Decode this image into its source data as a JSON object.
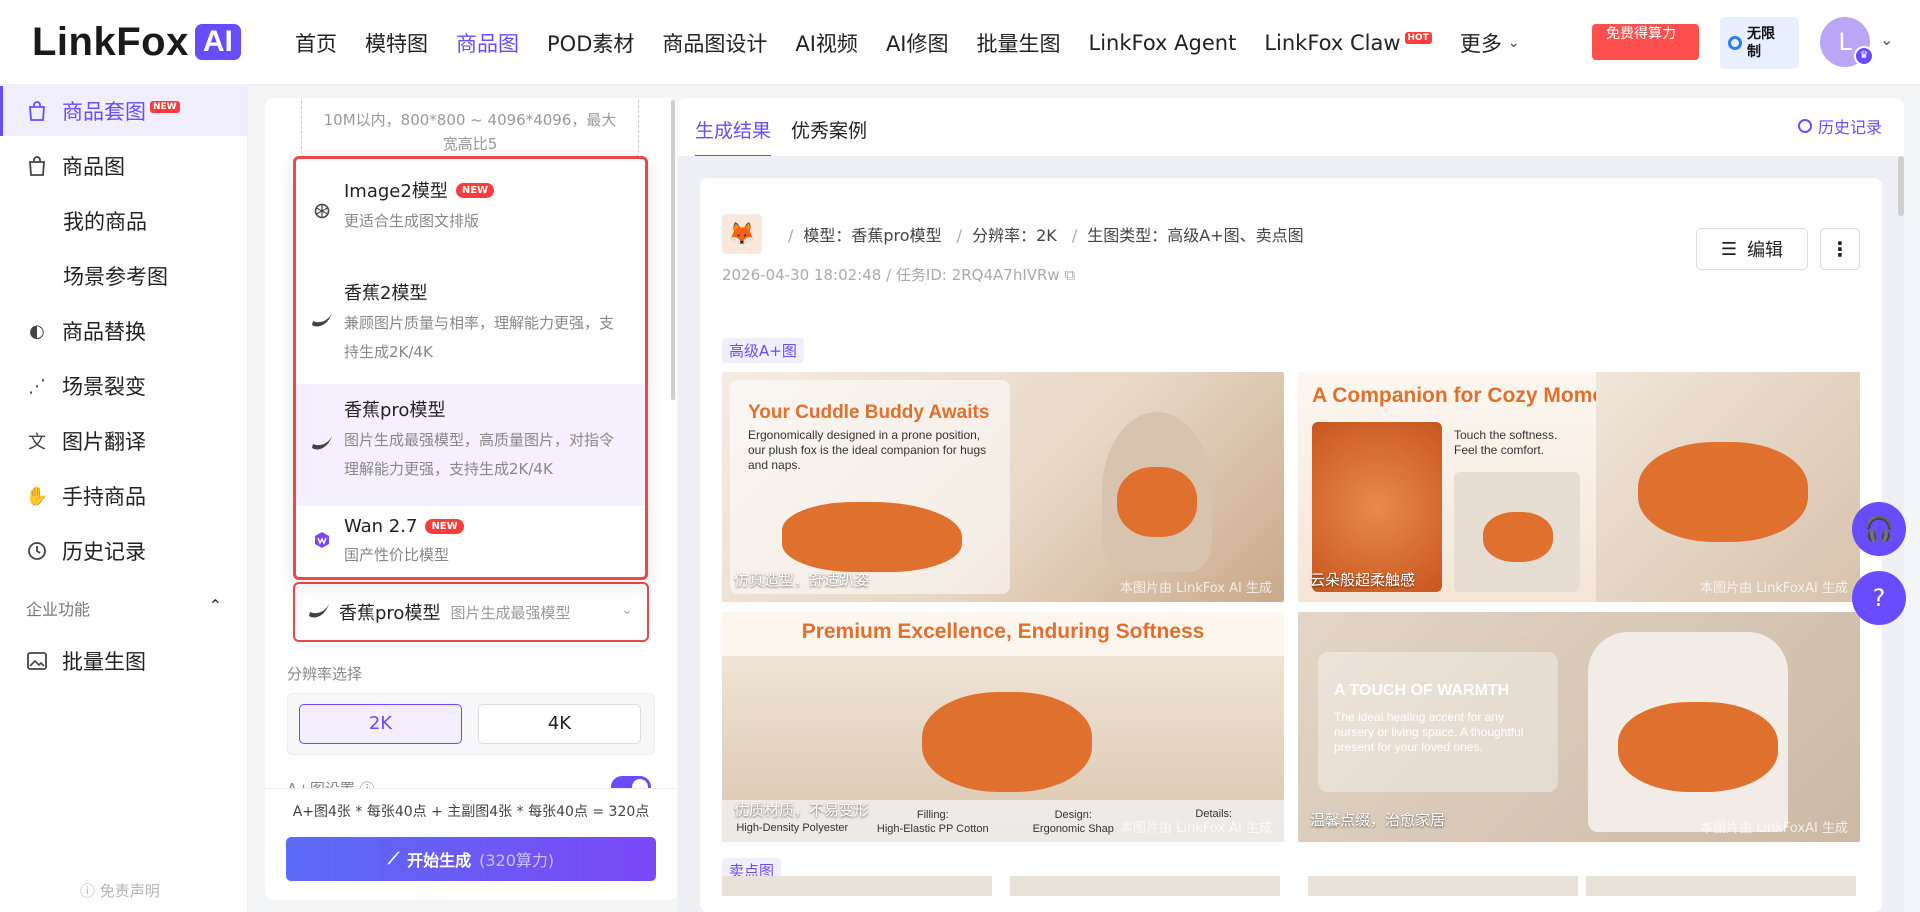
{
  "brand": {
    "name": "LinkFox",
    "ai": "AI"
  },
  "nav": {
    "items": [
      "首页",
      "模特图",
      "商品图",
      "POD素材",
      "商品图设计",
      "AI视频",
      "AI修图",
      "批量生图",
      "LinkFox Agent",
      "LinkFox Claw"
    ],
    "hot_badge": "HOT",
    "more": "更多",
    "promo": "免费得算力",
    "unlimited": "无限制",
    "avatar_initial": "L"
  },
  "sidebar": {
    "items": [
      "商品套图",
      "商品图",
      "我的商品",
      "场景参考图",
      "商品替换",
      "场景裂变",
      "图片翻译",
      "手持商品",
      "历史记录"
    ],
    "new_badge": "NEW",
    "group_title": "企业功能",
    "batch": "批量生图",
    "disclaimer": "免责声明"
  },
  "panel": {
    "upload_hint": "10M以内，800*800 ~ 4096*4096，最大宽高比5",
    "selected_model": "香蕉pro模型",
    "selected_model_desc": "图片生成最强模型",
    "resolution_label": "分辨率选择",
    "res_2k": "2K",
    "res_4k": "4K",
    "aplus_label": "A+图设置",
    "formula": "A+图4张 * 每张40点 + 主副图4张 * 每张40点 = 320点",
    "generate": "开始生成",
    "generate_cost": "(320算力)"
  },
  "dropdown": {
    "options": [
      {
        "title": "Image2模型",
        "badge": "NEW",
        "desc": "更适合生成图文排版"
      },
      {
        "title": "香蕉2模型",
        "badge": "",
        "desc": "兼顾图片质量与相率，理解能力更强，支持生成2K/4K"
      },
      {
        "title": "香蕉pro模型",
        "badge": "",
        "desc": "图片生成最强模型，高质量图片，对指令理解能力更强，支持生成2K/4K"
      },
      {
        "title": "Wan 2.7",
        "badge": "NEW",
        "desc": "国产性价比模型"
      }
    ]
  },
  "results": {
    "tab_results": "生成结果",
    "tab_cases": "优秀案例",
    "history": "历史记录",
    "meta_model": "模型：香蕉pro模型",
    "meta_res": "分辨率：2K",
    "meta_type": "生图类型：高级A+图、卖点图",
    "meta_sub": "2026-04-30 18:02:48 / 任务ID: 2RQ4A7hIVRw",
    "edit": "编辑",
    "section_aplus": "高级A+图",
    "section_selling": "卖点图",
    "watermark1": "本图片由 LinkFox AI 生成",
    "watermark2": "本图片由 LinkFoxAI 生成",
    "images": [
      {
        "headline": "Your Cuddle Buddy Awaits",
        "body": "Ergonomically designed in a prone position, our plush fox is the ideal companion for hugs and naps.",
        "caption": "仿真造型，舒适趴姿"
      },
      {
        "headline": "A Companion for Cozy Moments",
        "body": "Touch the softness. Feel the comfort.",
        "caption": "云朵般超柔触感"
      },
      {
        "headline": "Premium Excellence, Enduring Softness",
        "body": "",
        "caption": "优质材质，不易变形",
        "specs": [
          "High-Density Polyester",
          "Filling:",
          "High-Elastic PP Cotton",
          "Design:",
          "Ergonomic Shap",
          "Details:"
        ]
      },
      {
        "headline": "A TOUCH OF WARMTH",
        "body": "The ideal healing accent for any nursery or living space. A thoughtful present for your loved ones.",
        "caption": "温馨点缀，治愈家居"
      }
    ]
  },
  "colors": {
    "accent": "#6a4cff",
    "danger": "#e84a4a",
    "fox": "#e0702e"
  }
}
